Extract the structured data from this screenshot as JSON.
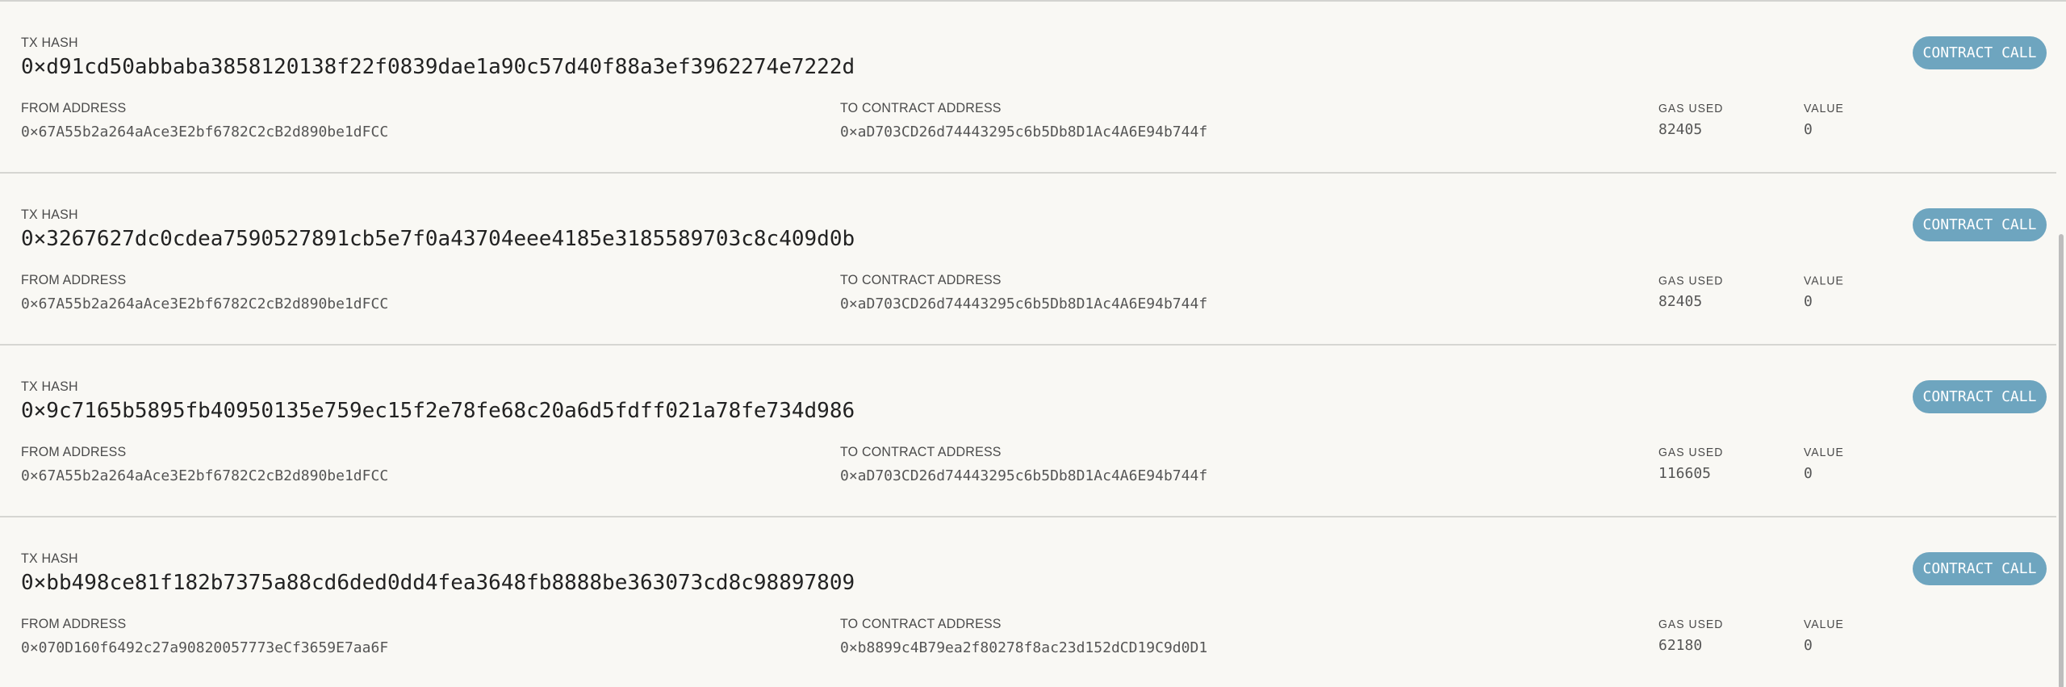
{
  "labels": {
    "tx_hash": "TX HASH",
    "from_address": "FROM ADDRESS",
    "to_contract_address": "TO CONTRACT ADDRESS",
    "gas_used": "GAS USED",
    "value": "VALUE"
  },
  "transactions": [
    {
      "hash": "0×d91cd50abbaba3858120138f22f0839dae1a90c57d40f88a3ef3962274e7222d",
      "from": "0×67A55b2a264aAce3E2bf6782C2cB2d890be1dFCC",
      "to": "0×aD703CD26d74443295c6b5Db8D1Ac4A6E94b744f",
      "gas_used": "82405",
      "value": "0",
      "tag": "CONTRACT CALL"
    },
    {
      "hash": "0×3267627dc0cdea7590527891cb5e7f0a43704eee4185e3185589703c8c409d0b",
      "from": "0×67A55b2a264aAce3E2bf6782C2cB2d890be1dFCC",
      "to": "0×aD703CD26d74443295c6b5Db8D1Ac4A6E94b744f",
      "gas_used": "82405",
      "value": "0",
      "tag": "CONTRACT CALL"
    },
    {
      "hash": "0×9c7165b5895fb40950135e759ec15f2e78fe68c20a6d5fdff021a78fe734d986",
      "from": "0×67A55b2a264aAce3E2bf6782C2cB2d890be1dFCC",
      "to": "0×aD703CD26d74443295c6b5Db8D1Ac4A6E94b744f",
      "gas_used": "116605",
      "value": "0",
      "tag": "CONTRACT CALL"
    },
    {
      "hash": "0×bb498ce81f182b7375a88cd6ded0dd4fea3648fb8888be363073cd8c98897809",
      "from": "0×070D160f6492c27a90820057773eCf3659E7aa6F",
      "to": "0×b8899c4B79ea2f80278f8ac23d152dCD19C9d0D1",
      "gas_used": "62180",
      "value": "0",
      "tag": "CONTRACT CALL"
    }
  ],
  "colors": {
    "background": "#f9f8f4",
    "tag_background": "#6ea5bf",
    "divider": "#d6d6d2"
  }
}
